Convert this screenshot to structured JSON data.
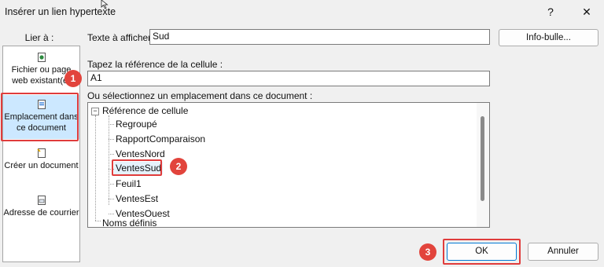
{
  "dialog": {
    "title": "Insérer un lien hypertexte",
    "help_label": "?",
    "close_label": "✕"
  },
  "sidebar": {
    "header": "Lier à :",
    "items": [
      {
        "label": "Fichier ou page web existant(e)",
        "icon": "web-page-icon"
      },
      {
        "label": "Emplacement dans ce document",
        "icon": "document-location-icon"
      },
      {
        "label": "Créer un document",
        "icon": "new-document-icon"
      },
      {
        "label": "Adresse de courrier",
        "icon": "email-address-icon"
      }
    ]
  },
  "display_text": {
    "label": "Texte à afficher :",
    "value": "Sud"
  },
  "screentip_button": "Info-bulle...",
  "cell_ref": {
    "label": "Tapez la référence de la cellule :",
    "value": "A1"
  },
  "location": {
    "label": "Ou sélectionnez un emplacement dans ce document :",
    "tree": {
      "group1": {
        "label": "Référence de cellule",
        "toggle": "−"
      },
      "items": [
        "Regroupé",
        "RapportComparaison",
        "VentesNord",
        "VentesSud",
        "Feuil1",
        "VentesEst",
        "VentesOuest"
      ],
      "selected": "VentesSud",
      "group2": {
        "label": "Noms définis"
      }
    }
  },
  "buttons": {
    "ok": "OK",
    "cancel": "Annuler"
  },
  "badges": [
    "1",
    "2",
    "3"
  ],
  "colors": {
    "callout_red": "#e2443c",
    "selection_blue": "#cce8ff"
  }
}
